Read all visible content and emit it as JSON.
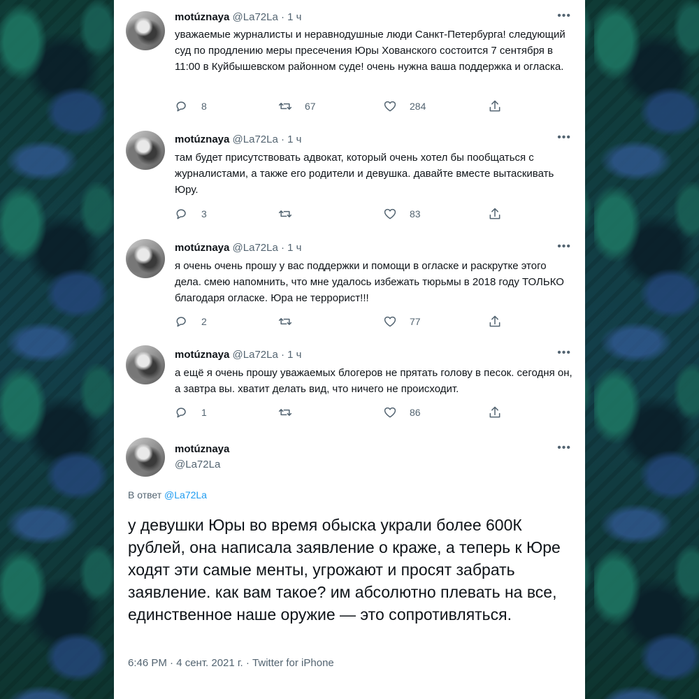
{
  "tweets": [
    {
      "name": "motúznaya",
      "handle": "@La72La",
      "sep": "·",
      "time": "1 ч",
      "text": "уважаемые журналисты и неравнодушные люди Санкт-Петербурга! следующий суд по продлению меры пресечения Юры Хованского состоится 7 сентября в 11:00 в Куйбышевском районном суде! очень нужна ваша поддержка и огласка.",
      "replies": "8",
      "retweets": "67",
      "likes": "284"
    },
    {
      "name": "motúznaya",
      "handle": "@La72La",
      "sep": "·",
      "time": "1 ч",
      "text": "там будет присутствовать адвокат, который очень хотел бы пообщаться с журналистами, а также его родители и девушка. давайте вместе вытаскивать Юру.",
      "replies": "3",
      "retweets": "",
      "likes": "83"
    },
    {
      "name": "motúznaya",
      "handle": "@La72La",
      "sep": "·",
      "time": "1 ч",
      "text": "я очень очень прошу у вас поддержки и помощи в огласке и раскрутке этого дела. смею напомнить, что мне удалось избежать тюрьмы в 2018 году ТОЛЬКО благодаря огласке. Юра не террорист!!!",
      "replies": "2",
      "retweets": "",
      "likes": "77"
    },
    {
      "name": "motúznaya",
      "handle": "@La72La",
      "sep": "·",
      "time": "1 ч",
      "text": "а ещё я очень прошу уважаемых блогеров не прятать голову в песок. сегодня он, а завтра вы. хватит делать вид, что ничего не происходит.",
      "replies": "1",
      "retweets": "",
      "likes": "86"
    }
  ],
  "main_tweet": {
    "name": "motúznaya",
    "handle": "@La72La",
    "reply_prefix": "В ответ",
    "reply_to": "@La72La",
    "text": "у девушки Юры во время обыска украли более 600К рублей, она написала заявление о краже, а теперь к Юре ходят эти самые менты, угрожают и просят забрать заявление. как вам такое? им абсолютно плевать на все, единственное наше оружие — это сопротивляться.",
    "footer": "6:46 PM · 4 сент. 2021 г. · Twitter for iPhone"
  },
  "icons": {
    "reply": "reply-icon",
    "retweet": "retweet-icon",
    "like": "like-icon",
    "share": "share-icon",
    "more": "more-icon"
  },
  "colors": {
    "link": "#1d9bf0",
    "secondary_text": "#536471",
    "primary_text": "#0f1419"
  }
}
